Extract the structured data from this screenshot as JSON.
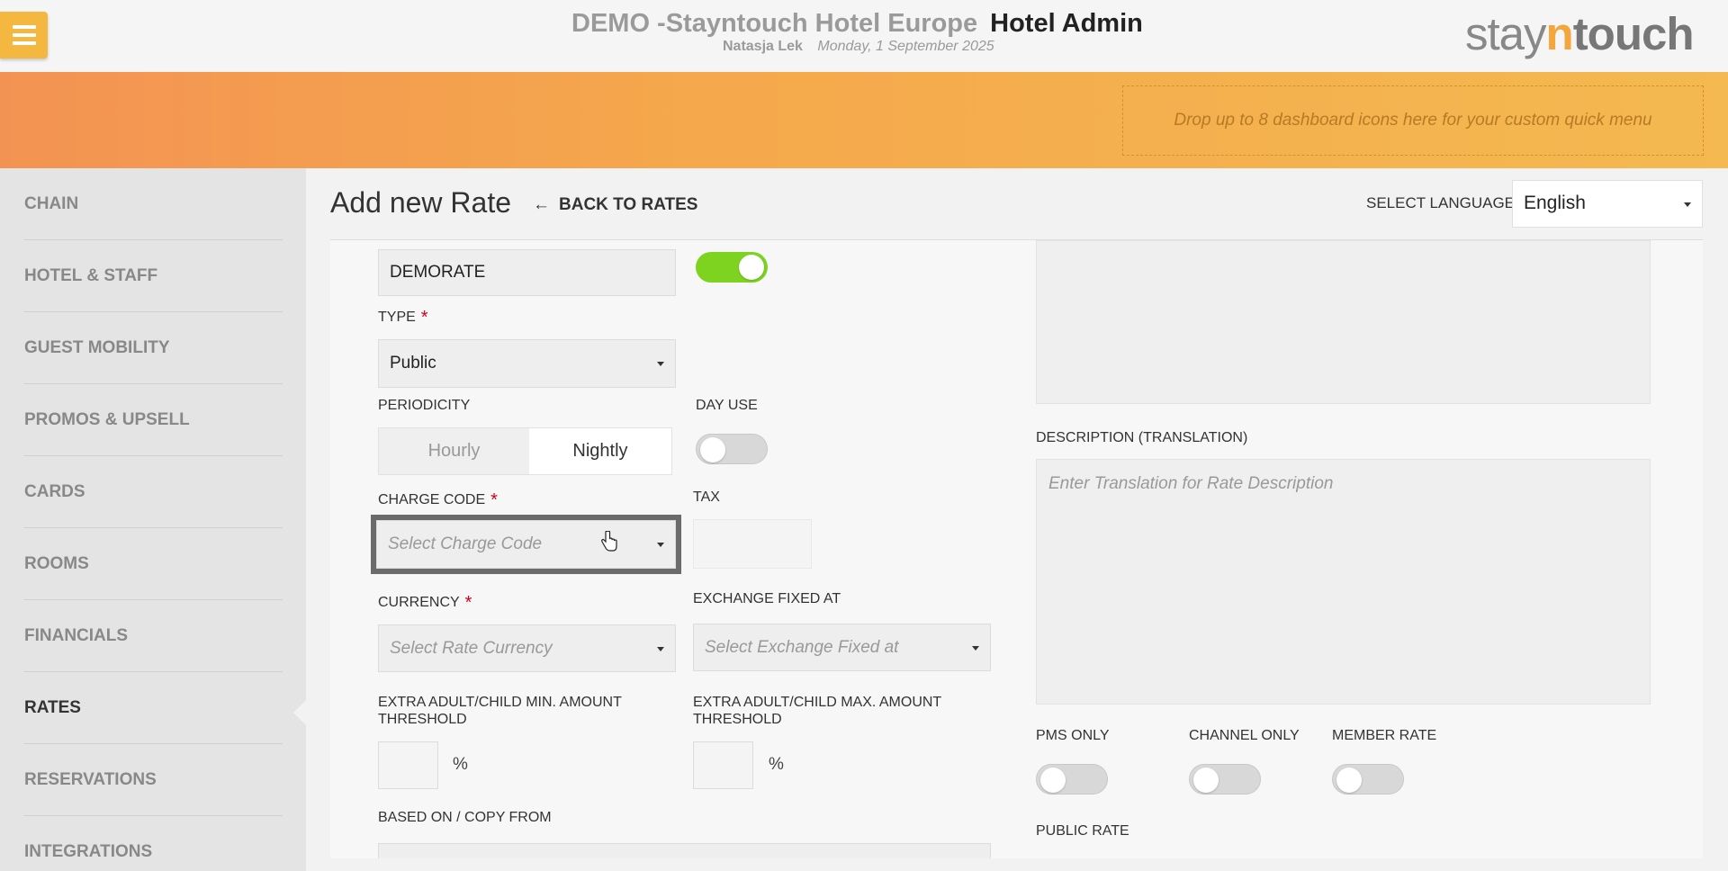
{
  "header": {
    "hotel_name": "DEMO -Stayntouch Hotel Europe",
    "admin_title": "Hotel Admin",
    "user_name": "Natasja Lek",
    "date": "Monday, 1 September 2025",
    "logo": {
      "part1": "stay",
      "part2": "n",
      "part3": "touch"
    }
  },
  "banner": {
    "dropzone_text": "Drop up to 8 dashboard icons here for your custom quick menu"
  },
  "sidebar": {
    "items": [
      {
        "label": "CHAIN"
      },
      {
        "label": "HOTEL & STAFF"
      },
      {
        "label": "GUEST MOBILITY"
      },
      {
        "label": "PROMOS & UPSELL"
      },
      {
        "label": "CARDS"
      },
      {
        "label": "ROOMS"
      },
      {
        "label": "FINANCIALS"
      },
      {
        "label": "RATES",
        "active": true
      },
      {
        "label": "RESERVATIONS"
      },
      {
        "label": "INTEGRATIONS"
      }
    ]
  },
  "main": {
    "title": "Add new Rate",
    "back_label": "BACK TO RATES",
    "back_arrow": "←",
    "language_label": "SELECT LANGUAGE",
    "language_value": "English"
  },
  "form": {
    "rate_name_value": "DEMORATE",
    "type_label": "TYPE",
    "type_value": "Public",
    "periodicity_label": "PERIODICITY",
    "periodicity_options": [
      "Hourly",
      "Nightly"
    ],
    "periodicity_selected": "Nightly",
    "day_use_label": "DAY USE",
    "charge_code_label": "CHARGE CODE",
    "charge_code_placeholder": "Select Charge Code",
    "tax_label": "TAX",
    "currency_label": "CURRENCY",
    "currency_placeholder": "Select Rate Currency",
    "exchange_label": "EXCHANGE FIXED AT",
    "exchange_placeholder": "Select Exchange Fixed at",
    "min_threshold_label_1": "EXTRA ADULT/CHILD MIN. AMOUNT",
    "min_threshold_label_2": "THRESHOLD",
    "max_threshold_label_1": "EXTRA ADULT/CHILD MAX. AMOUNT",
    "max_threshold_label_2": "THRESHOLD",
    "percent_symbol": "%",
    "based_on_label": "BASED ON / COPY FROM",
    "required_mark": "*",
    "description_translation_label": "DESCRIPTION (TRANSLATION)",
    "description_translation_placeholder": "Enter Translation for Rate Description",
    "pms_only_label": "PMS ONLY",
    "channel_only_label": "CHANNEL ONLY",
    "member_rate_label": "MEMBER RATE",
    "public_rate_label": "PUBLIC RATE"
  },
  "colors": {
    "accent": "#f4b740",
    "toggle_on": "#7ed321",
    "required": "#d0021b"
  },
  "icons": {
    "menu": "hamburger-icon",
    "back": "arrow-left-icon",
    "caret": "caret-down-icon",
    "cursor": "hand-pointer-icon"
  }
}
